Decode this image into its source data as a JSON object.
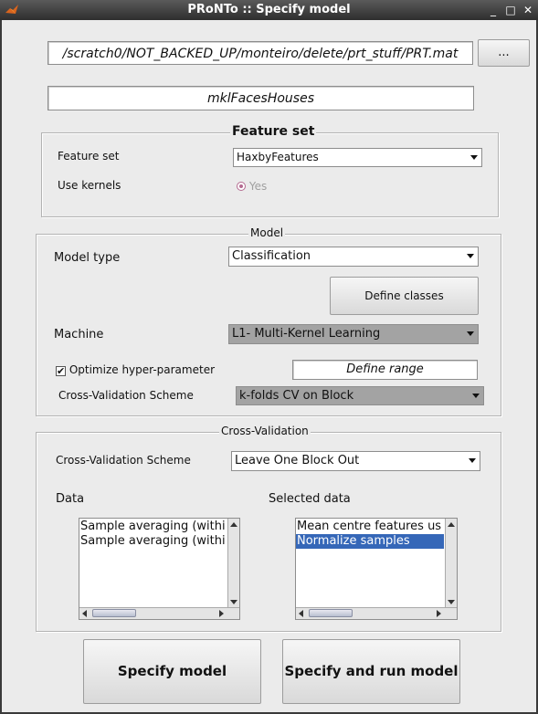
{
  "window": {
    "title": "PRoNTo :: Specify model"
  },
  "file_path": "/scratch0/NOT_BACKED_UP/monteiro/delete/prt_stuff/PRT.mat",
  "browse_button": "...",
  "model_name": "mklFacesHouses",
  "feature_set_panel": {
    "title": "Feature set",
    "feature_set_label": "Feature set",
    "feature_set_value": "HaxbyFeatures",
    "use_kernels_label": "Use kernels",
    "use_kernels_option": "Yes"
  },
  "model_panel": {
    "title": "Model",
    "model_type_label": "Model type",
    "model_type_value": "Classification",
    "define_classes_button": "Define classes",
    "machine_label": "Machine",
    "machine_value": "L1- Multi-Kernel Learning",
    "optimize_label": "Optimize hyper-parameter",
    "optimize_checked": true,
    "define_range_value": "Define range",
    "cv_scheme_label": "Cross-Validation Scheme",
    "cv_scheme_value": "k-folds CV on Block"
  },
  "cv_panel": {
    "title": "Cross-Validation",
    "cv_scheme_label": "Cross-Validation Scheme",
    "cv_scheme_value": "Leave One Block Out",
    "data_label": "Data",
    "selected_label": "Selected data",
    "data_items": [
      "Sample averaging (withi",
      "Sample averaging (withi"
    ],
    "selected_items": [
      "Mean centre features us",
      "Normalize samples"
    ]
  },
  "buttons": {
    "specify": "Specify model",
    "specify_run": "Specify and run model"
  }
}
